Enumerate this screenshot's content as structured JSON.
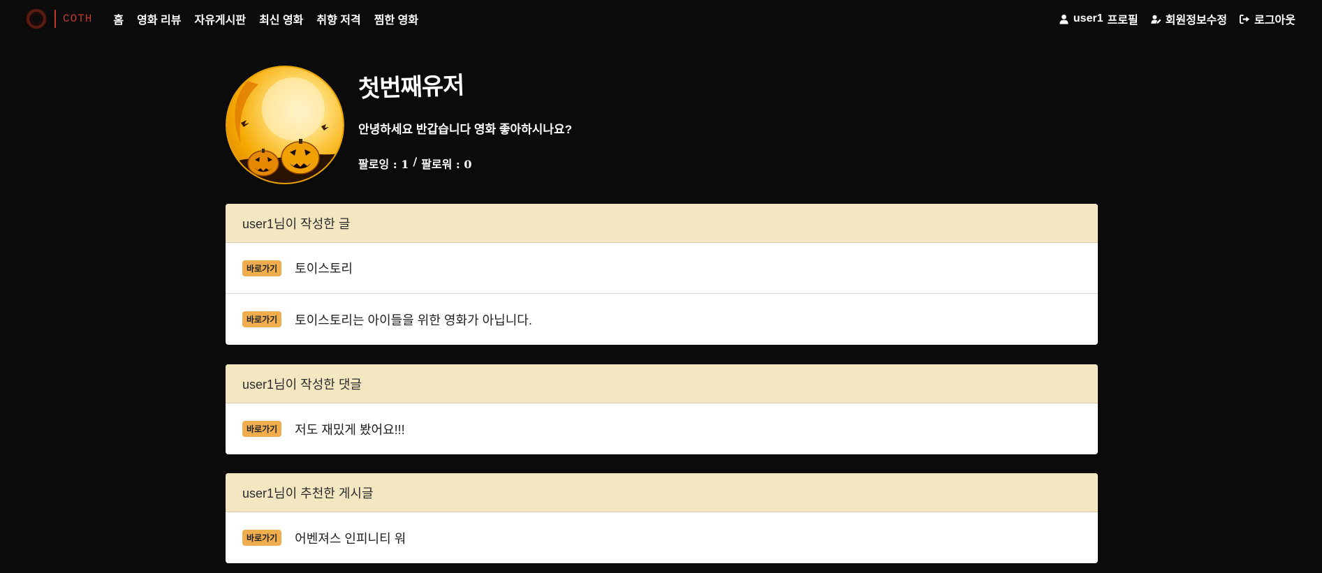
{
  "nav": {
    "brand": "COTH",
    "links": [
      "홈",
      "영화 리뷰",
      "자유게시판",
      "최신 영화",
      "취향 저격",
      "찜한 영화"
    ],
    "profile_user": "user1",
    "profile_label": "프로필",
    "edit_label": "회원정보수정",
    "logout_label": "로그아웃"
  },
  "profile": {
    "name": "첫번째유저",
    "bio": "안녕하세요 반갑습니다 영화 좋아하시나요?",
    "following": "팔로잉 : 1",
    "separator": "/",
    "followers": "팔로워 : 0"
  },
  "sections": [
    {
      "title": "user1님이 작성한 글",
      "items": [
        {
          "badge": "바로가기",
          "text": "토이스토리"
        },
        {
          "badge": "바로가기",
          "text": "토이스토리는 아이들을 위한 영화가 아닙니다."
        }
      ]
    },
    {
      "title": "user1님이 작성한 댓글",
      "items": [
        {
          "badge": "바로가기",
          "text": "저도 재밌게 봤어요!!!"
        }
      ]
    },
    {
      "title": "user1님이 추천한 게시글",
      "items": [
        {
          "badge": "바로가기",
          "text": "어벤져스 인피니티 워"
        }
      ]
    }
  ],
  "colors": {
    "background": "#0b0b0b",
    "card_header": "#f3e7c2",
    "badge": "#f0ad4e",
    "brand": "#c0392b"
  },
  "icons": {
    "profile": "user-icon",
    "edit": "user-edit-icon",
    "logout": "sign-out-icon"
  }
}
